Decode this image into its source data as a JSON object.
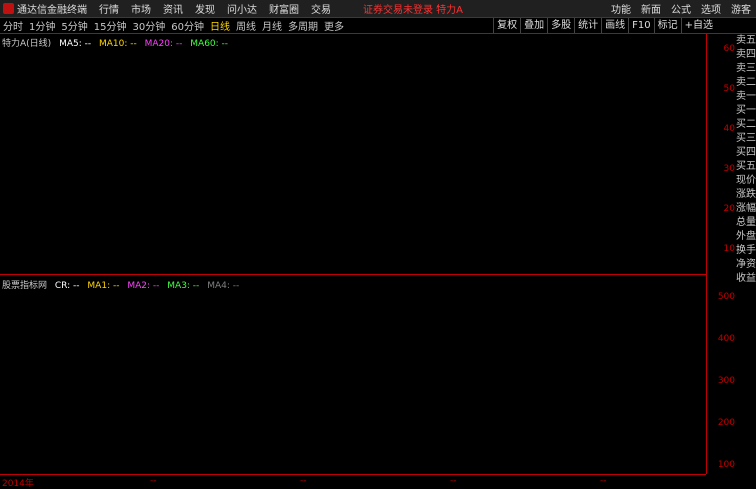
{
  "app": {
    "name": "通达信金融终端"
  },
  "menu": [
    "行情",
    "市场",
    "资讯",
    "发现",
    "问小达",
    "财富圈",
    "交易"
  ],
  "alert": "证券交易未登录 特力A",
  "right_menu": [
    "功能",
    "新面",
    "公式",
    "选项",
    "游客"
  ],
  "periods": [
    {
      "label": "分时",
      "active": false
    },
    {
      "label": "1分钟",
      "active": false
    },
    {
      "label": "5分钟",
      "active": false
    },
    {
      "label": "15分钟",
      "active": false
    },
    {
      "label": "30分钟",
      "active": false
    },
    {
      "label": "60分钟",
      "active": false
    },
    {
      "label": "日线",
      "active": true
    },
    {
      "label": "周线",
      "active": false
    },
    {
      "label": "月线",
      "active": false
    },
    {
      "label": "多周期",
      "active": false
    },
    {
      "label": "更多",
      "active": false
    }
  ],
  "tools": [
    "复权",
    "叠加",
    "多股",
    "统计",
    "画线",
    "F10",
    "标记",
    "+自选"
  ],
  "main_legend": {
    "title": "特力A(日线)",
    "items": [
      {
        "text": "MA5: --",
        "color": "#ffffff"
      },
      {
        "text": "MA10: --",
        "color": "#ffd700"
      },
      {
        "text": "MA20: --",
        "color": "#ff40ff"
      },
      {
        "text": "MA60: --",
        "color": "#40ff40"
      }
    ]
  },
  "sub_legend": {
    "title": "股票指标网",
    "items": [
      {
        "text": "CR: --",
        "color": "#ffffff"
      },
      {
        "text": "MA1: --",
        "color": "#ffd700"
      },
      {
        "text": "MA2: --",
        "color": "#ff40ff"
      },
      {
        "text": "MA3: --",
        "color": "#40ff40"
      },
      {
        "text": "MA4: --",
        "color": "#808080"
      }
    ]
  },
  "chart_data": {
    "type": "line",
    "note_placeholder": true,
    "price_axis": {
      "ylim": [
        0,
        60
      ],
      "ticks": [
        10,
        20,
        30,
        40,
        50,
        60
      ]
    },
    "cr_axis": {
      "ylim": [
        0,
        500
      ],
      "ticks": [
        100,
        200,
        300,
        400,
        500
      ]
    },
    "x_ticks": [
      "2014年",
      "--",
      "--",
      "--",
      "--"
    ],
    "series": []
  },
  "quote_labels": [
    "卖五",
    "卖四",
    "卖三",
    "卖二",
    "卖一",
    "买一",
    "买二",
    "买三",
    "买四",
    "买五",
    "现价",
    "涨跌",
    "涨幅",
    "总量",
    "外盘",
    "换手",
    "净资",
    "收益"
  ]
}
